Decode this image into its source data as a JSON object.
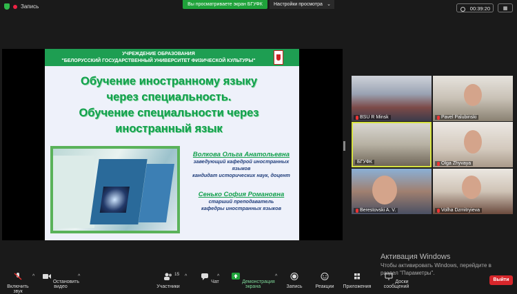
{
  "topbar": {
    "record_label": "Запись",
    "sharing_banner": "Вы просматриваете экран БГУФК",
    "view_options": "Настройки просмотра",
    "timer": "00:39:20",
    "view_label": "Вид"
  },
  "slide": {
    "header_line1": "УЧРЕЖДЕНИЕ ОБРАЗОВАНИЯ",
    "header_line2": "\"БЕЛОРУССКИЙ ГОСУДАРСТВЕННЫЙ УНИВЕРСИТЕТ ФИЗИЧЕСКОЙ КУЛЬТУРЫ\"",
    "title_lines": [
      "Обучение иностранному языку",
      "через специальность.",
      "Обучение специальности через",
      "иностранный язык"
    ],
    "author1_name": "Волкова Ольга Анатольевна",
    "author1_role_lines": [
      "заведующий кафедрой иностранных",
      "языков",
      "кандидат исторических наук, доцент"
    ],
    "author2_name": "Сенько София Романовна",
    "author2_role_lines": [
      "старший преподаватель",
      "кафедры иностранных языков"
    ]
  },
  "participants": [
    {
      "name": "BSU R Minsk"
    },
    {
      "name": "Pavel Palubinski"
    },
    {
      "name": "БГУФК"
    },
    {
      "name": "Olga Zhyvaya"
    },
    {
      "name": "Berestovski A. V."
    },
    {
      "name": "Volha Dzmitryieva"
    }
  ],
  "watermark": {
    "title": "Активация Windows",
    "line1": "Чтобы активировать Windows, перейдите в",
    "line2": "раздел \"Параметры\"."
  },
  "toolbar": {
    "mute": "Включить звук",
    "video": "Остановить видео",
    "participants": "Участники",
    "participants_count": "15",
    "chat": "Чат",
    "share": "Демонстрация экрана",
    "record": "Запись",
    "reactions": "Реакции",
    "apps": "Приложения",
    "whiteboards": "Доски сообщений",
    "leave": "Выйти"
  },
  "colors": {
    "share_green": "#1fa23a",
    "slide_green": "#12a04c",
    "leave_red": "#d7262b",
    "active_speaker": "#d6e241"
  }
}
